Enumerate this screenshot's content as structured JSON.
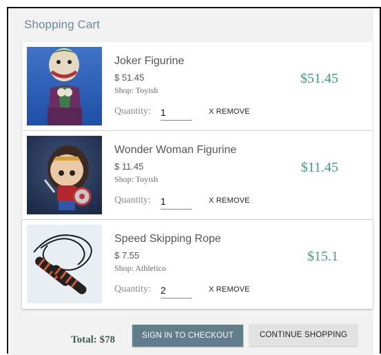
{
  "cart": {
    "title": "Shopping Cart",
    "quantity_label": "Quantity:",
    "remove_label": "X REMOVE",
    "items": [
      {
        "name": "Joker Figurine",
        "price": "$ 51.45",
        "shop": "Shop: Toyish",
        "quantity": "1",
        "line_total": "$51.45",
        "image": "joker-figurine-image"
      },
      {
        "name": "Wonder Woman Figurine",
        "price": "$ 11.45",
        "shop": "Shop: Toyish",
        "quantity": "1",
        "line_total": "$11.45",
        "image": "wonder-woman-figurine-image"
      },
      {
        "name": "Speed Skipping Rope",
        "price": "$ 7.55",
        "shop": "Shop: Athletico",
        "quantity": "2",
        "line_total": "$15.1",
        "image": "skipping-rope-image"
      }
    ]
  },
  "footer": {
    "total": "Total: $78",
    "checkout_label": "SIGN IN TO CHECKOUT",
    "continue_label": "CONTINUE SHOPPING"
  },
  "colors": {
    "title": "#6b8797",
    "price_accent": "#3e9f7a",
    "checkout_button": "#627e8c",
    "continue_button": "#e2e2e2"
  }
}
